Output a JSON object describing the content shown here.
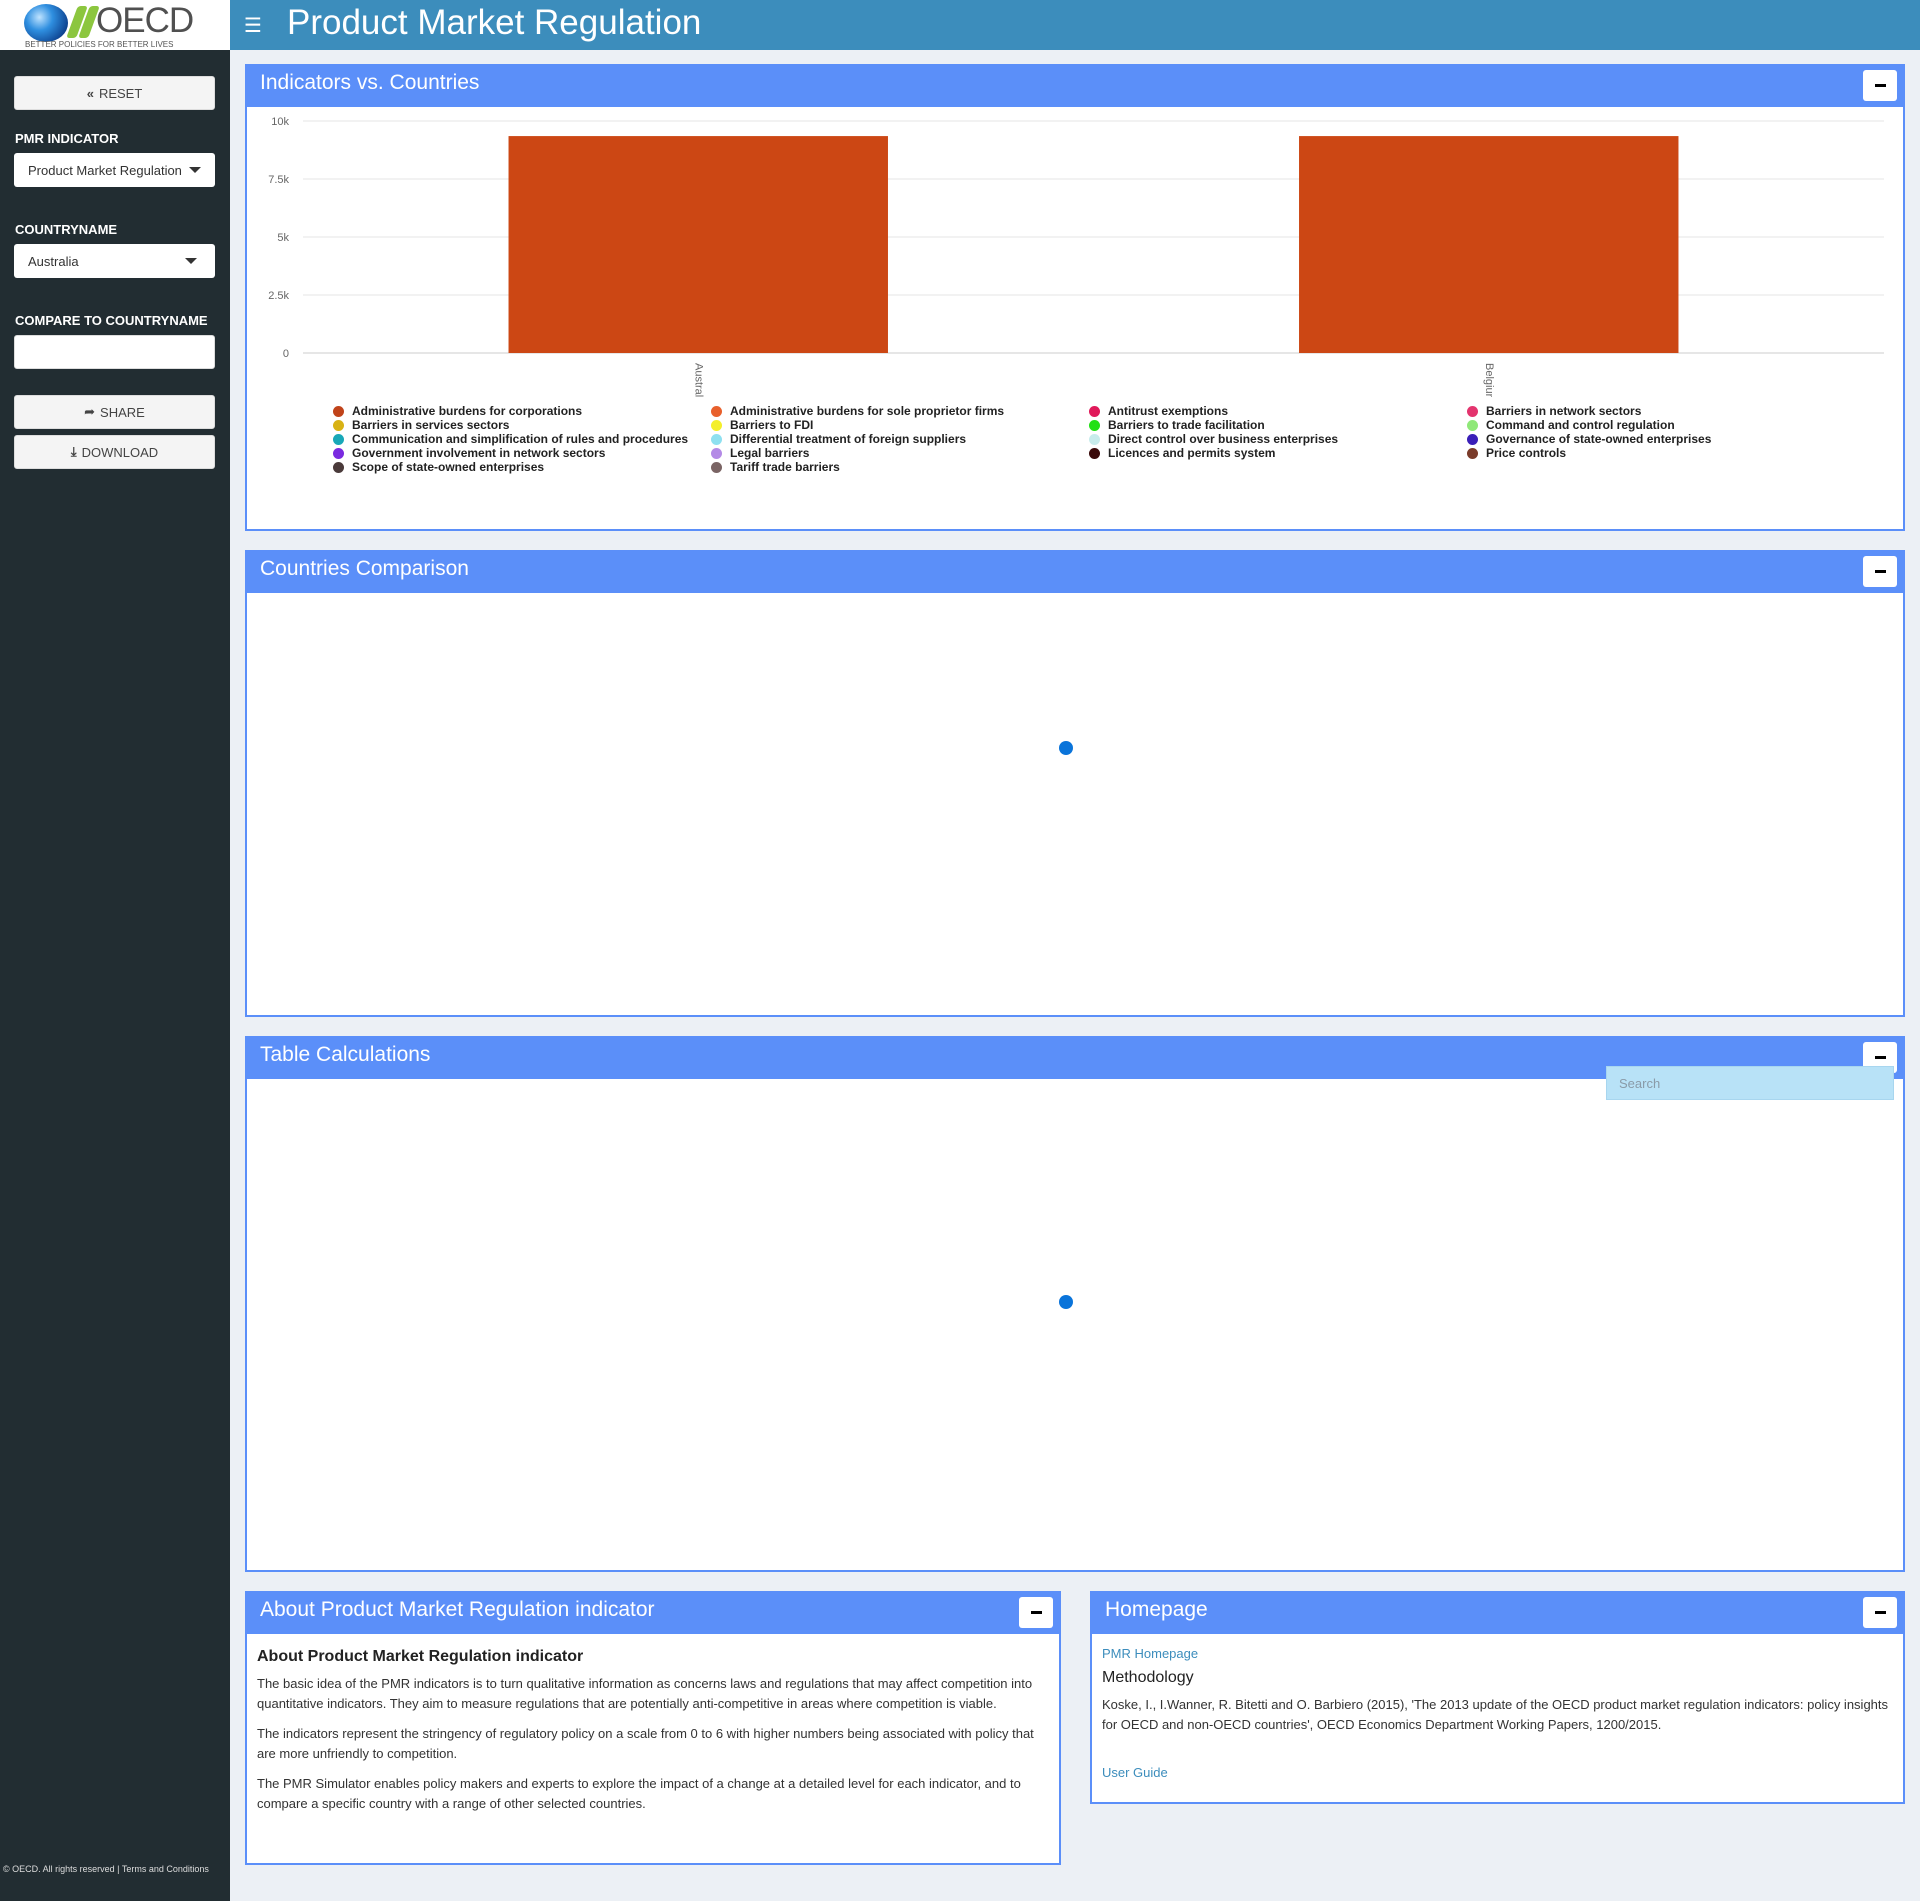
{
  "logo": {
    "name": "OECD",
    "tagline": "BETTER POLICIES FOR BETTER LIVES"
  },
  "header": {
    "title": "Product Market Regulation",
    "menu_icon": "☰"
  },
  "sidebar": {
    "reset_label": "RESET",
    "reset_icon": "«",
    "indicator_label": "PMR INDICATOR",
    "indicator_value": "Product Market Regulation",
    "country_label": "COUNTRYNAME",
    "country_value": "Australia",
    "compare_label": "COMPARE TO COUNTRYNAME",
    "compare_value": "",
    "share_label": "SHARE",
    "share_icon": "➦",
    "download_label": "DOWNLOAD",
    "download_icon": "⤓",
    "footer": "© OECD. All rights reserved | Terms and Conditions"
  },
  "panels": {
    "indicators": "Indicators vs. Countries",
    "comparison": "Countries Comparison",
    "table": "Table Calculations",
    "about": "About Product Market Regulation indicator",
    "homepage": "Homepage"
  },
  "table": {
    "search_placeholder": "Search"
  },
  "about": {
    "heading": "About Product Market Regulation indicator",
    "p1": "The basic idea of the PMR indicators is to turn qualitative information as concerns laws and regulations that may affect competition into quantitative indicators. They aim to measure regulations that are potentially anti-competitive in areas where competition is viable.",
    "p2": "The indicators represent the stringency of regulatory policy on a scale from 0 to 6 with higher numbers being associated with policy that are more unfriendly to competition.",
    "p3": "The PMR Simulator enables policy makers and experts to explore the impact of a change at a detailed level for each indicator, and to compare a specific country with a range of other selected countries."
  },
  "homepage": {
    "pmr_link": "PMR Homepage",
    "methodology": "Methodology",
    "citation": "Koske, I., I.Wanner, R. Bitetti and O. Barbiero (2015), 'The 2013 update of the OECD product market regulation indicators: policy insights for OECD and non-OECD countries', OECD Economics Department Working Papers, 1200/2015.",
    "guide_link": "User Guide"
  },
  "chart_data": {
    "type": "bar",
    "categories": [
      "Australia",
      "Belgium"
    ],
    "values": [
      9350,
      9350
    ],
    "bar_color": "#cc4714",
    "yticks": [
      "0",
      "2.5k",
      "5k",
      "7.5k",
      "10k"
    ],
    "ylim": [
      0,
      10000
    ],
    "grid": true,
    "legend_position": "bottom",
    "legend": [
      {
        "name": "Administrative burdens for corporations",
        "color": "#c0431a"
      },
      {
        "name": "Administrative burdens for sole proprietor firms",
        "color": "#e8602c"
      },
      {
        "name": "Antitrust exemptions",
        "color": "#e0195a"
      },
      {
        "name": "Barriers in network sectors",
        "color": "#e3346e"
      },
      {
        "name": "Barriers in services sectors",
        "color": "#d8b214"
      },
      {
        "name": "Barriers to FDI",
        "color": "#f4ef2a"
      },
      {
        "name": "Barriers to trade facilitation",
        "color": "#22e016"
      },
      {
        "name": "Command and control regulation",
        "color": "#8fe878"
      },
      {
        "name": "Communication and simplification of rules and procedures",
        "color": "#18a8b8"
      },
      {
        "name": "Differential treatment of foreign suppliers",
        "color": "#8ee0f0"
      },
      {
        "name": "Direct control over business enterprises",
        "color": "#c8ecec"
      },
      {
        "name": "Governance of state-owned enterprises",
        "color": "#3a1fb8"
      },
      {
        "name": "Government involvement in network sectors",
        "color": "#7a2ae0"
      },
      {
        "name": "Legal barriers",
        "color": "#b48ae6"
      },
      {
        "name": "Licences and permits system",
        "color": "#3a0a0a"
      },
      {
        "name": "Price controls",
        "color": "#7a3b2a"
      },
      {
        "name": "Scope of state-owned enterprises",
        "color": "#4a3a3a"
      },
      {
        "name": "Tariff trade barriers",
        "color": "#7a6464"
      }
    ]
  }
}
